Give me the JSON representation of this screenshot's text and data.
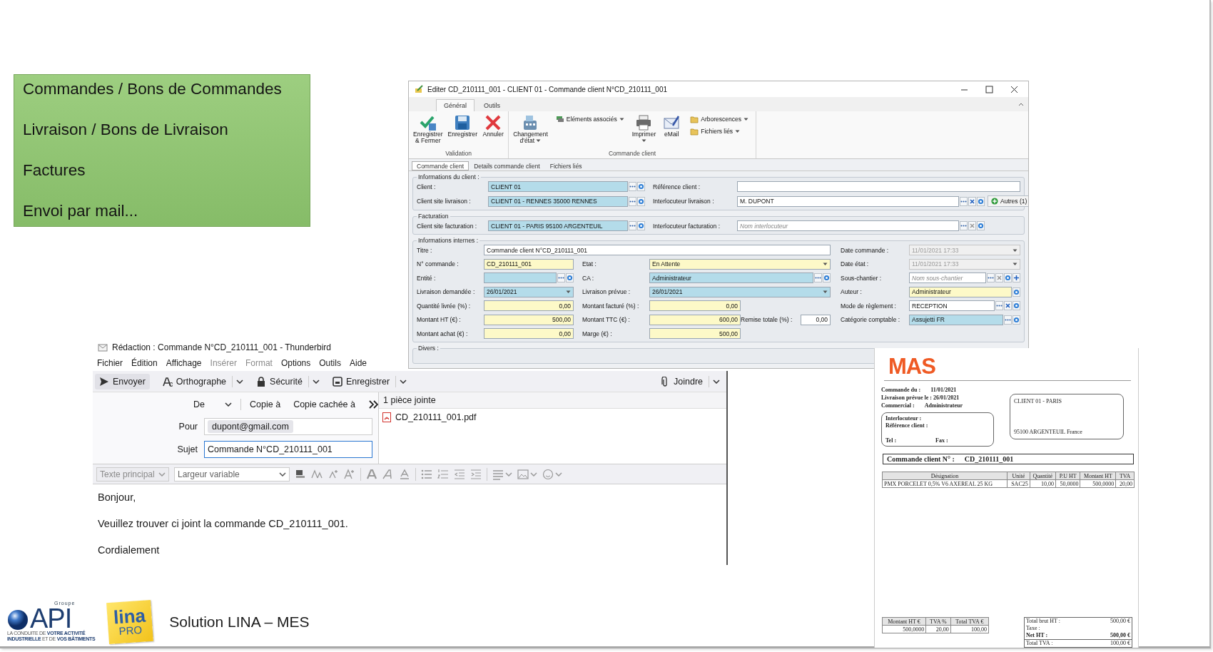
{
  "topic_panel": {
    "items": [
      "Commandes / Bons de Commandes",
      "Livraison / Bons de Livraison",
      "Factures",
      "Envoi par mail..."
    ]
  },
  "erp_window": {
    "title": "Editer CD_210111_001 - CLIENT 01 - Commande client N°CD_210111_001",
    "ribbon_tabs": [
      {
        "label": "Général",
        "selected": true
      },
      {
        "label": "Outils",
        "selected": false
      }
    ],
    "ribbon_groups": [
      {
        "label": "Validation",
        "buttons": [
          {
            "label": "Enregistrer & Fermer",
            "kind": "large",
            "dropdown": false
          },
          {
            "label": "Enregistrer",
            "kind": "large",
            "dropdown": false
          },
          {
            "label": "Annuler",
            "kind": "large",
            "dropdown": false
          }
        ]
      },
      {
        "label": "Commande client",
        "buttons": [
          {
            "label": "Changement d'état",
            "kind": "large",
            "dropdown": true
          },
          {
            "label": "Eléments associés",
            "kind": "small",
            "dropdown": true
          },
          {
            "label": "Imprimer",
            "kind": "large",
            "dropdown": true
          },
          {
            "label": "eMail",
            "kind": "large",
            "dropdown": false
          },
          {
            "label": "Arborescences",
            "kind": "small",
            "dropdown": true
          },
          {
            "label": "Fichiers liés",
            "kind": "small",
            "dropdown": true
          }
        ]
      }
    ],
    "form_tabs": [
      {
        "label": "Commande client",
        "selected": true
      },
      {
        "label": "Details commande client",
        "selected": false
      },
      {
        "label": "Fichiers liés",
        "selected": false
      }
    ],
    "sections": [
      {
        "title": "Informations du client :",
        "kind": "two_column",
        "rows": [
          [
            {
              "label": "Client :",
              "value": "CLIENT 01",
              "kind": "text",
              "color": "#b4dcea",
              "disabled": false,
              "actions": [
                {
                  "kind": "ellipsis"
                },
                {
                  "kind": "goto"
                }
              ]
            },
            {
              "label": "Référence client :",
              "kind": "text",
              "color": "#ffffff",
              "disabled": false
            }
          ],
          [
            {
              "label": "Client site livraison :",
              "value": "CLIENT 01 - RENNES 35000 RENNES",
              "kind": "text",
              "color": "#b4dcea",
              "disabled": false,
              "actions": [
                {
                  "kind": "ellipsis"
                },
                {
                  "kind": "goto"
                }
              ]
            },
            {
              "label": "Interlocuteur livraison :",
              "value": "M. DUPONT",
              "kind": "text",
              "color": "#ffffff",
              "disabled": false,
              "actions": [
                {
                  "kind": "ellipsis"
                },
                {
                  "kind": "clear"
                },
                {
                  "kind": "goto"
                }
              ],
              "extra_button": "Autres (1)"
            }
          ]
        ]
      },
      {
        "title": "Facturation",
        "kind": "two_column",
        "rows": [
          [
            {
              "label": "Client site facturation :",
              "value": "CLIENT 01 - PARIS 95100 ARGENTEUIL",
              "kind": "text",
              "color": "#b4dcea",
              "disabled": false,
              "actions": [
                {
                  "kind": "ellipsis"
                },
                {
                  "kind": "goto"
                }
              ]
            },
            {
              "label": "Interlocuteur facturation :",
              "placeholder": "Nom interlocuteur",
              "kind": "text",
              "color": "#ffffff",
              "disabled": false,
              "actions": [
                {
                  "kind": "ellipsis"
                },
                {
                  "kind": "clear_off"
                },
                {
                  "kind": "goto"
                }
              ]
            }
          ]
        ]
      },
      {
        "title": "Informations internes :",
        "kind": "four_column",
        "rows": [
          [
            {
              "label": "Titre :",
              "value": "Commande client N°CD_210111_001",
              "kind": "text",
              "color": "#ffffff",
              "disabled": false
            },
            null,
            null,
            {
              "label": "Date commande :",
              "value": "11/01/2021 17:33",
              "kind": "combo",
              "color": "#f0f0f0",
              "disabled": true
            }
          ],
          [
            {
              "label": "N° commande :",
              "value": "CD_210111_001",
              "kind": "text",
              "color": "#fdf9c8",
              "disabled": false
            },
            {
              "label": "Etat :",
              "value": "En Attente",
              "kind": "combo",
              "color": "#fdf9c8",
              "disabled": false
            },
            null,
            {
              "label": "Date état :",
              "value": "11/01/2021 17:33",
              "kind": "combo",
              "color": "#f0f0f0",
              "disabled": true
            }
          ],
          [
            {
              "label": "Entité :",
              "kind": "text",
              "color": "#b4dcea",
              "disabled": false,
              "actions": [
                {
                  "kind": "ellipsis"
                },
                {
                  "kind": "goto"
                }
              ]
            },
            {
              "label": "CA :",
              "value": "Administrateur",
              "kind": "text",
              "color": "#b4dcea",
              "disabled": false,
              "actions": [
                {
                  "kind": "ellipsis"
                },
                {
                  "kind": "goto"
                }
              ]
            },
            null,
            {
              "label": "Sous-chantier :",
              "placeholder": "Nom sous-chantier",
              "kind": "text",
              "color": "#ffffff",
              "disabled": false,
              "actions": [
                {
                  "kind": "ellipsis"
                },
                {
                  "kind": "clear_off"
                },
                {
                  "kind": "goto"
                },
                {
                  "kind": "add"
                }
              ]
            }
          ],
          [
            {
              "label": "Livraison demandée :",
              "value": "26/01/2021",
              "kind": "combo",
              "color": "#b4dcea",
              "disabled": false
            },
            {
              "label": "Livraison prévue :",
              "value": "26/01/2021",
              "kind": "combo",
              "color": "#b4dcea",
              "disabled": false
            },
            null,
            {
              "label": "Auteur :",
              "value": "Administrateur",
              "kind": "text",
              "color": "#fdf9c8",
              "disabled": false,
              "actions": [
                {
                  "kind": "goto"
                }
              ]
            }
          ],
          [
            {
              "label": "Quantité livrée (%) :",
              "value": "0,00",
              "kind": "number",
              "color": "#fdf9c8",
              "disabled": false
            },
            {
              "label": "Montant facturé (%) :",
              "value": "0,00",
              "kind": "number",
              "color": "#fdf9c8",
              "disabled": false
            },
            null,
            {
              "label": "Mode de règlement :",
              "value": "RECEPTION",
              "kind": "text",
              "color": "#ffffff",
              "disabled": false,
              "actions": [
                {
                  "kind": "ellipsis"
                },
                {
                  "kind": "clear"
                },
                {
                  "kind": "goto"
                }
              ]
            }
          ],
          [
            {
              "label": "Montant HT (€) :",
              "value": "500,00",
              "kind": "number",
              "color": "#fdf9c8",
              "disabled": false
            },
            {
              "label": "Montant TTC (€) :",
              "value": "600,00",
              "kind": "number",
              "color": "#fdf9c8",
              "disabled": false
            },
            {
              "label": "Remise totale (%) :",
              "value": "0,00",
              "kind": "number",
              "color": "#ffffff",
              "disabled": false
            },
            {
              "label": "Catégorie comptable :",
              "value": "Assujetti FR",
              "kind": "text",
              "color": "#b4dcea",
              "disabled": false,
              "actions": [
                {
                  "kind": "ellipsis"
                },
                {
                  "kind": "goto"
                }
              ]
            }
          ],
          [
            {
              "label": "Montant achat (€) :",
              "value": "0,00",
              "kind": "number",
              "color": "#fdf9c8",
              "disabled": false
            },
            {
              "label": "Marge (€) :",
              "value": "500,00",
              "kind": "number",
              "color": "#fdf9c8",
              "disabled": false
            },
            null,
            null
          ]
        ]
      },
      {
        "title": "Divers :",
        "kind": "header_only"
      }
    ]
  },
  "mail_window": {
    "title": "Rédaction : Commande N°CD_210111_001 - Thunderbird",
    "menu": [
      {
        "label": "Fichier",
        "disabled": false
      },
      {
        "label": "Édition",
        "disabled": false
      },
      {
        "label": "Affichage",
        "disabled": false
      },
      {
        "label": "Insérer",
        "disabled": true
      },
      {
        "label": "Format",
        "disabled": true
      },
      {
        "label": "Options",
        "disabled": false
      },
      {
        "label": "Outils",
        "disabled": false
      },
      {
        "label": "Aide",
        "disabled": false
      }
    ],
    "toolbar": [
      {
        "label": "Envoyer",
        "dropdown": false
      },
      {
        "label": "Orthographe",
        "dropdown": true
      },
      {
        "label": "Sécurité",
        "dropdown": true
      },
      {
        "label": "Enregistrer",
        "dropdown": true
      },
      {
        "label": "Joindre",
        "dropdown": true
      }
    ],
    "from_label": "De",
    "recipient_options": [
      "Copie à",
      "Copie cachée à"
    ],
    "fields": [
      {
        "label": "Pour",
        "value": "dupont@gmail.com",
        "kind": "chip",
        "focused": false
      },
      {
        "label": "Sujet",
        "value": "Commande N°CD_210111_001",
        "kind": "text",
        "focused": true
      }
    ],
    "attachments": {
      "header": "1 pièce jointe",
      "files": [
        "CD_210111_001.pdf"
      ]
    },
    "format_bar": [
      {
        "value": "Texte principal",
        "disabled": true
      },
      {
        "value": "Largeur variable",
        "disabled": false
      }
    ],
    "body": [
      "Bonjour,",
      "Veuillez trouver ci joint la commande CD_210111_001.",
      "Cordialement"
    ]
  },
  "order_document": {
    "logo": "MAS",
    "meta": [
      {
        "label": "Commande du :",
        "value": "11/01/2021"
      },
      {
        "label": "Livraison prévue le : 26/01/2021"
      },
      {
        "label": "Commercial :",
        "value": "Administrateur"
      }
    ],
    "contact_box": {
      "lines": [
        "Interlocuteur :",
        "Référence client :"
      ],
      "phone": "Tel :",
      "fax": "Fax :"
    },
    "address_box": [
      "CLIENT 01 - PARIS",
      "95100 ARGENTEUIL France"
    ],
    "heading": {
      "label": "Commande client N° :",
      "value": "CD_210111_001"
    },
    "lines": {
      "columns": [
        "Désignation",
        "Unité",
        "Quantité",
        "P.U HT",
        "Montant HT",
        "TVA"
      ],
      "rows": [
        [
          "PMX PORCELET 0,5% V6 AXEREAL 25 KG",
          "SAC25",
          "10,00",
          "50,0000",
          "500,0000",
          "20,00"
        ]
      ]
    },
    "vat_summary": {
      "columns": [
        "Montant HT €",
        "TVA %",
        "Total TVA €"
      ],
      "rows": [
        [
          "500,0000",
          "20,00",
          "100,00"
        ]
      ]
    },
    "totals": [
      {
        "label": "Total brut HT :",
        "value": "500,00 €",
        "bold": false
      },
      {
        "label": "Taxe :",
        "bold": false
      },
      {
        "label": "Net HT :",
        "value": "500,00 €",
        "bold": true
      },
      {
        "label": "Total TVA :",
        "value": "100,00 €",
        "bold": false
      }
    ]
  },
  "footer": {
    "api_logo": {
      "group": "Groupe",
      "name": "API",
      "tagline": [
        "LA CONDUITE DE **VOTRE ACTIVITÉ**",
        "**INDUSTRIELLE** ET DE **VOS BÂTIMENTS**"
      ]
    },
    "lina_logo": {
      "name": "lina",
      "badge": "PRO"
    },
    "title": "Solution LINA – MES"
  }
}
